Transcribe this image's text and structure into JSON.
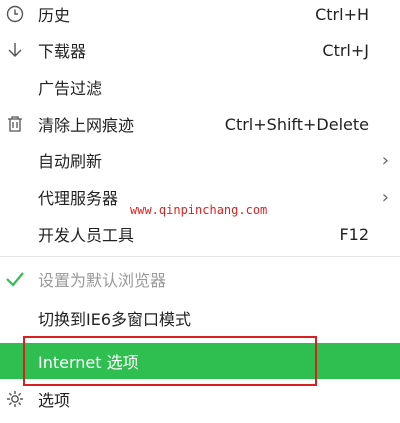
{
  "menu": {
    "items": [
      {
        "label": "历史",
        "shortcut": "Ctrl+H",
        "icon": "clock-icon"
      },
      {
        "label": "下载器",
        "shortcut": "Ctrl+J",
        "icon": "download-arrow-icon"
      },
      {
        "label": "广告过滤"
      },
      {
        "label": "清除上网痕迹",
        "shortcut": "Ctrl+Shift+Delete",
        "icon": "trash-icon"
      },
      {
        "label": "自动刷新",
        "submenu": true
      },
      {
        "label": "代理服务器",
        "submenu": true
      },
      {
        "label": "开发人员工具",
        "shortcut": "F12"
      },
      {
        "label": "设置为默认浏览器",
        "disabled": true,
        "checked": true,
        "icon": "checkmark-icon"
      },
      {
        "label": "切换到IE6多窗口模式"
      },
      {
        "label": "Internet 选项",
        "highlighted": true
      },
      {
        "label": "选项",
        "icon": "gear-icon"
      }
    ],
    "submenu_arrow": "›"
  },
  "watermark": "www.qinpinchang.com",
  "colors": {
    "highlight": "#2fbf50",
    "check": "#2fbf50",
    "annotation_box": "#d82020",
    "watermark": "#e02020"
  }
}
